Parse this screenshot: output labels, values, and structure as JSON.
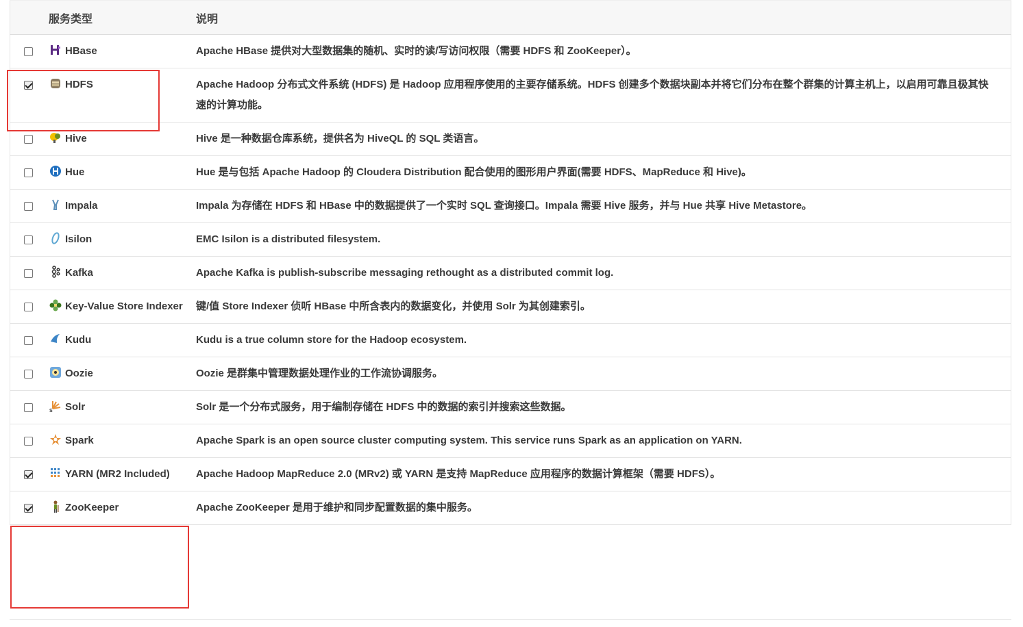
{
  "table": {
    "headers": {
      "service_type": "服务类型",
      "description": "说明"
    },
    "rows": [
      {
        "name": "HBase",
        "icon": "hbase-icon",
        "checked": false,
        "description": "Apache HBase 提供对大型数据集的随机、实时的读/写访问权限（需要 HDFS 和 ZooKeeper）。"
      },
      {
        "name": "HDFS",
        "icon": "hdfs-icon",
        "checked": true,
        "description": "Apache Hadoop 分布式文件系统 (HDFS) 是 Hadoop 应用程序使用的主要存储系统。HDFS 创建多个数据块副本并将它们分布在整个群集的计算主机上，以启用可靠且极其快速的计算功能。"
      },
      {
        "name": "Hive",
        "icon": "hive-icon",
        "checked": false,
        "description": "Hive 是一种数据仓库系统，提供名为 HiveQL 的 SQL 类语言。"
      },
      {
        "name": "Hue",
        "icon": "hue-icon",
        "checked": false,
        "description": "Hue 是与包括 Apache Hadoop 的 Cloudera Distribution 配合使用的图形用户界面(需要 HDFS、MapReduce 和 Hive)。"
      },
      {
        "name": "Impala",
        "icon": "impala-icon",
        "checked": false,
        "description": "Impala 为存储在 HDFS 和 HBase 中的数据提供了一个实时 SQL 查询接口。Impala 需要 Hive 服务，并与 Hue 共享 Hive Metastore。"
      },
      {
        "name": "Isilon",
        "icon": "isilon-icon",
        "checked": false,
        "description": "EMC Isilon is a distributed filesystem."
      },
      {
        "name": "Kafka",
        "icon": "kafka-icon",
        "checked": false,
        "description": "Apache Kafka is publish-subscribe messaging rethought as a distributed commit log."
      },
      {
        "name": "Key-Value Store Indexer",
        "icon": "key-value-store-icon",
        "checked": false,
        "description": "键/值 Store Indexer 侦听 HBase 中所含表内的数据变化，并使用 Solr 为其创建索引。"
      },
      {
        "name": "Kudu",
        "icon": "kudu-icon",
        "checked": false,
        "description": "Kudu is a true column store for the Hadoop ecosystem."
      },
      {
        "name": "Oozie",
        "icon": "oozie-icon",
        "checked": false,
        "description": "Oozie 是群集中管理数据处理作业的工作流协调服务。"
      },
      {
        "name": "Solr",
        "icon": "solr-icon",
        "checked": false,
        "description": "Solr 是一个分布式服务，用于编制存储在 HDFS 中的数据的索引并搜索这些数据。"
      },
      {
        "name": "Spark",
        "icon": "spark-icon",
        "checked": false,
        "description": "Apache Spark is an open source cluster computing system. This service runs Spark as an application on YARN."
      },
      {
        "name": "YARN (MR2 Included)",
        "icon": "yarn-icon",
        "checked": true,
        "description": "Apache Hadoop MapReduce 2.0 (MRv2) 或 YARN 是支持 MapReduce 应用程序的数据计算框架（需要 HDFS）。"
      },
      {
        "name": "ZooKeeper",
        "icon": "zookeeper-icon",
        "checked": true,
        "description": "Apache ZooKeeper 是用于维护和同步配置数据的集中服务。"
      }
    ]
  },
  "colors": {
    "highlight": "#e53935",
    "text": "#3a3a3a",
    "border": "#e4e4e4",
    "header_bg": "#f7f7f7"
  }
}
